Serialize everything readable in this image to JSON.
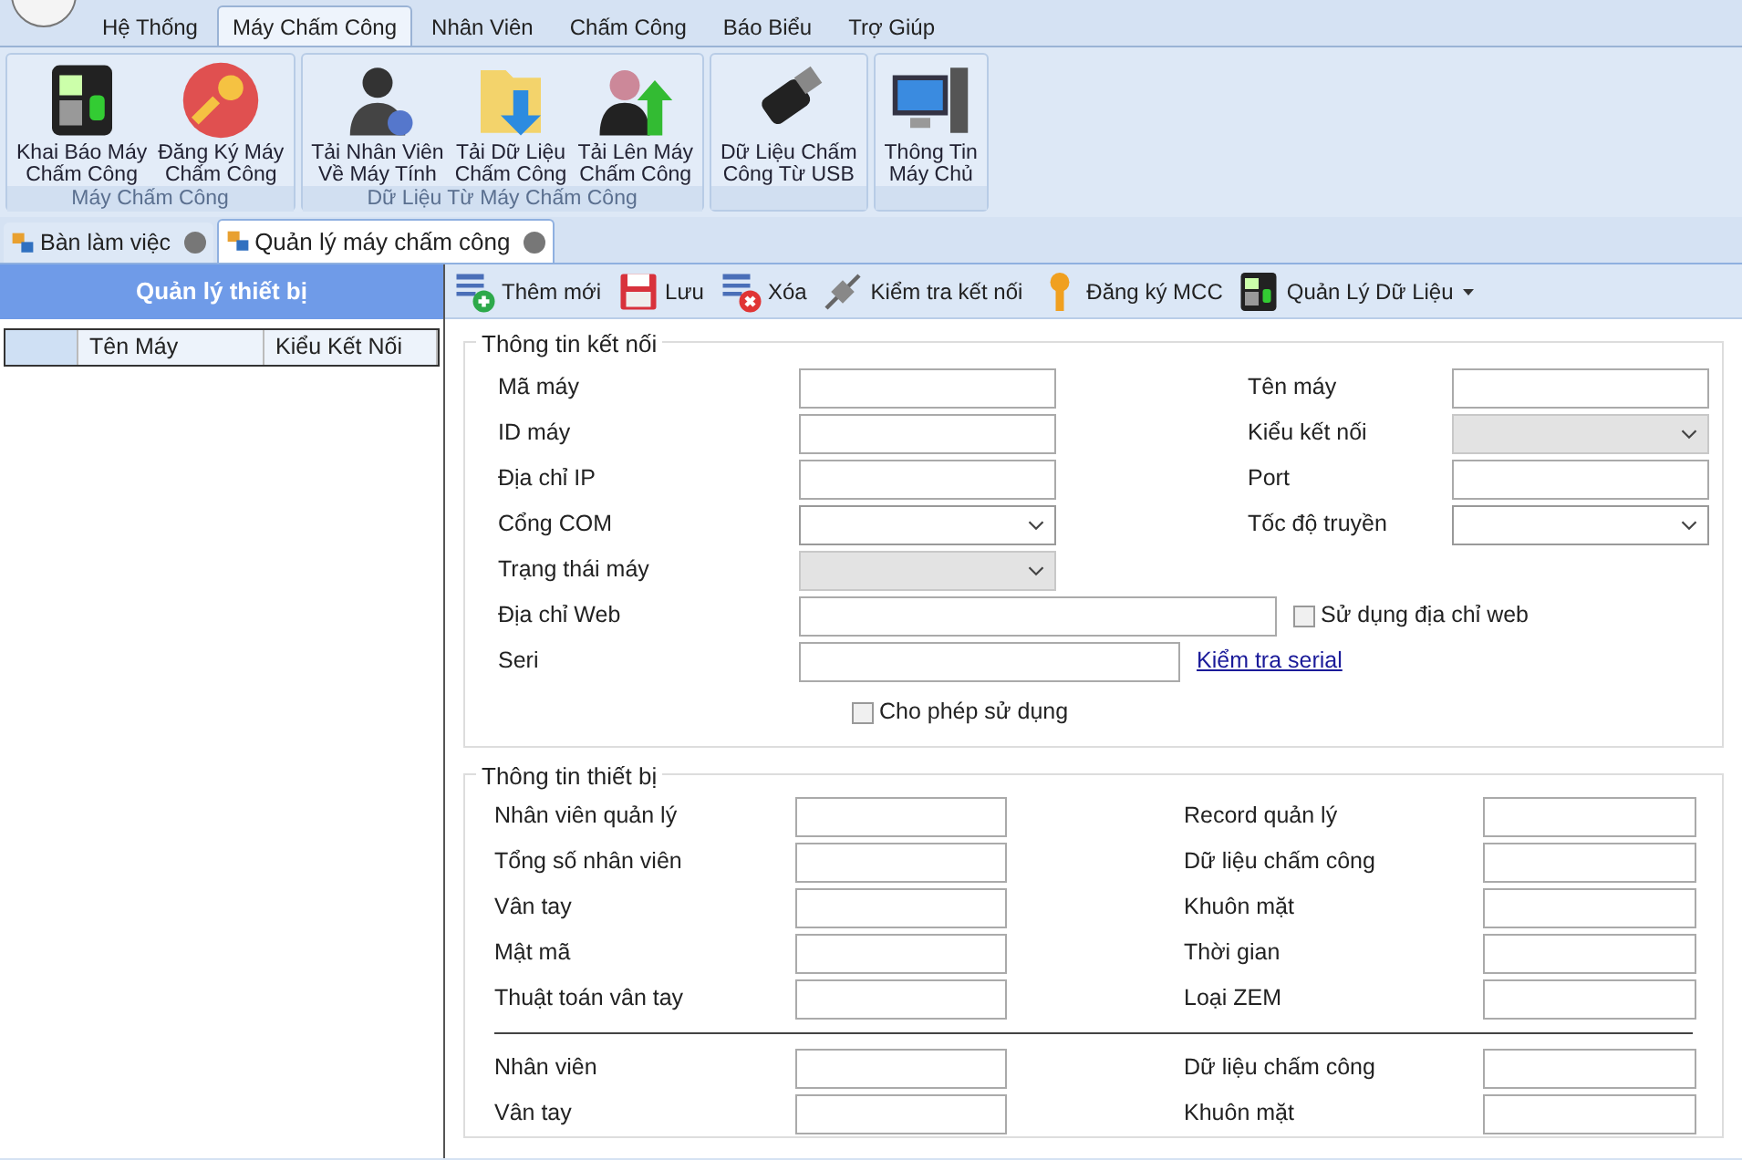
{
  "ribbon_tabs": [
    {
      "label": "Hệ Thống",
      "selected": false
    },
    {
      "label": "Máy Chấm Công",
      "selected": true
    },
    {
      "label": "Nhân Viên",
      "selected": false
    },
    {
      "label": "Chấm Công",
      "selected": false
    },
    {
      "label": "Báo Biểu",
      "selected": false
    },
    {
      "label": "Trợ Giúp",
      "selected": false
    }
  ],
  "ribbon_groups": [
    {
      "label": "Máy Chấm Công",
      "buttons": [
        {
          "label": "Khai Báo Máy\nChấm Công",
          "kind": "device"
        },
        {
          "label": "Đăng Ký Máy\nChấm Công",
          "kind": "key"
        }
      ]
    },
    {
      "label": "Dữ Liệu Từ Máy Chấm Công",
      "buttons": [
        {
          "label": "Tải Nhân Viên\nVề Máy Tính",
          "kind": "people"
        },
        {
          "label": "Tải Dữ Liệu\nChấm Công",
          "kind": "folder"
        },
        {
          "label": "Tải Lên Máy\nChấm Công",
          "kind": "upload"
        }
      ]
    },
    {
      "buttons": [
        {
          "label": "Dữ Liệu Chấm\nCông Từ USB",
          "kind": "usb"
        }
      ]
    },
    {
      "buttons": [
        {
          "label": "Thông Tin\nMáy Chủ",
          "kind": "computer"
        }
      ]
    }
  ],
  "doc_tabs": [
    {
      "label": "Bàn làm việc",
      "selected": false
    },
    {
      "label": "Quản lý máy chấm công",
      "selected": true
    }
  ],
  "side_panel": {
    "title": "Quản lý thiết bị",
    "columns": [
      "Tên Máy",
      "Kiểu Kết Nối"
    ]
  },
  "toolbar": [
    {
      "label": "Thêm mới",
      "kind": "add"
    },
    {
      "label": "Lưu",
      "kind": "save"
    },
    {
      "label": "Xóa",
      "kind": "delete"
    },
    {
      "label": "Kiểm tra kết nối",
      "kind": "plug"
    },
    {
      "label": "Đăng ký MCC",
      "kind": "key"
    },
    {
      "label": "Quản Lý Dữ Liệu",
      "kind": "device",
      "dropdown": true
    }
  ],
  "connection": {
    "title": "Thông tin kết nối",
    "rows": [
      {
        "left": {
          "label": "Mã máy",
          "kind": "text"
        },
        "right": {
          "label": "Tên máy",
          "kind": "text"
        }
      },
      {
        "left": {
          "label": "ID máy",
          "kind": "text"
        },
        "right": {
          "label": "Kiểu kết nối",
          "kind": "select",
          "disabled": true
        }
      },
      {
        "left": {
          "label": "Địa chỉ IP",
          "kind": "text"
        },
        "right": {
          "label": "Port",
          "kind": "text"
        }
      },
      {
        "left": {
          "label": "Cổng COM",
          "kind": "select",
          "disabled": false
        },
        "right": {
          "label": "Tốc độ truyền",
          "kind": "select",
          "disabled": false
        }
      },
      {
        "left": {
          "label": "Trạng thái máy",
          "kind": "select",
          "disabled": true
        }
      },
      {
        "left": {
          "label": "Địa chỉ Web",
          "kind": "wide"
        },
        "extra": {
          "kind": "checkbox",
          "label": "Sử dụng địa chỉ web",
          "checked": false
        }
      },
      {
        "left": {
          "label": "Seri",
          "kind": "medium"
        },
        "extra": {
          "kind": "link",
          "label": "Kiểm tra serial"
        }
      },
      {
        "extra": {
          "kind": "checkbox",
          "label": "Cho phép sử dụng",
          "checked": false
        }
      }
    ]
  },
  "device_info": {
    "title": "Thông tin thiết bị",
    "rows": [
      {
        "left": "Nhân viên quản lý",
        "right": "Record quản lý"
      },
      {
        "left": "Tổng số nhân viên",
        "right": "Dữ liệu chấm công"
      },
      {
        "left": "Vân tay",
        "right": "Khuôn mặt"
      },
      {
        "left": "Mật mã",
        "right": "Thời gian"
      },
      {
        "left": "Thuật toán vân tay",
        "right": "Loại ZEM"
      }
    ],
    "rows_below": [
      {
        "left": "Nhân viên",
        "right": "Dữ liệu chấm công"
      },
      {
        "left": "Vân tay",
        "right": "Khuôn mặt"
      }
    ]
  }
}
